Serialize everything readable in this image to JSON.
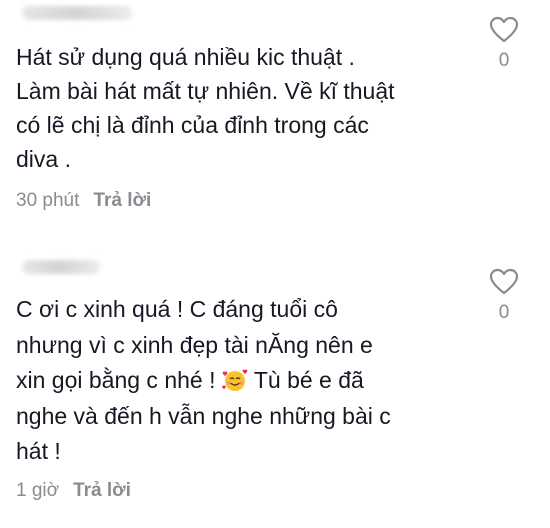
{
  "comments": [
    {
      "text": "Hát sử dụng quá nhiều kic thuật .\nLàm bài hát mất tự nhiên. Về kĩ thuật\ncó lẽ chị là đỉnh của đỉnh trong các\ndiva .",
      "time": "30 phút",
      "reply_label": "Trả lời",
      "likes": "0"
    },
    {
      "text_part1": "C ơi c xinh quá ! C đáng tuổi cô\nnhưng vì c xinh đẹp tài nĂng nên e\nxin gọi bằng c nhé ! ",
      "emoji_icon": "smiling-face-with-hearts-icon",
      "text_part2": " Tù bé e đã\nnghe và đến h vẫn nghe những bài c\nhát !",
      "time": "1 giờ",
      "reply_label": "Trả lời",
      "likes": "0"
    }
  ],
  "colors": {
    "text": "#161823",
    "meta": "#8a8b91",
    "heart_stroke": "#8a8b91"
  }
}
